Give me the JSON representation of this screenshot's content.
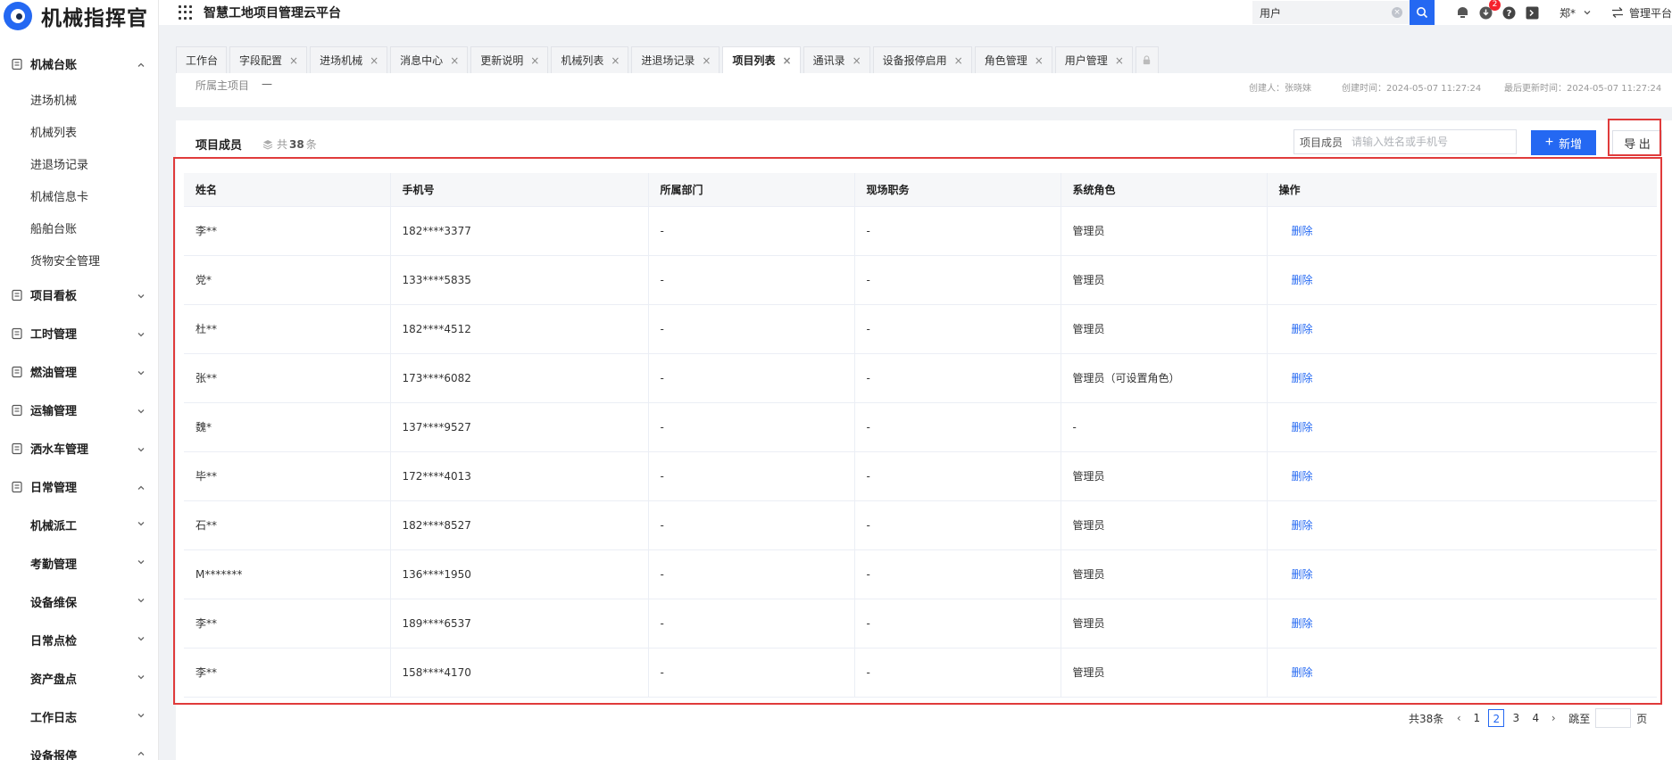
{
  "brand": {
    "name": "机械指挥官",
    "accent": "#2468f2",
    "highlight": "#e03b3b"
  },
  "topbar": {
    "title": "智慧工地项目管理云平台",
    "search_value": "用户",
    "notification_badge": "2",
    "user_name": "郑*",
    "switch_label": "管理平台",
    "icons": [
      "grid-icon",
      "search-icon",
      "message-icon",
      "download-icon",
      "help-icon",
      "terminal-icon",
      "swap-icon"
    ]
  },
  "sidebar": {
    "groups": [
      {
        "label": "机械台账",
        "icon": "ledger-icon",
        "expanded": true,
        "items": [
          "进场机械",
          "机械列表",
          "进退场记录",
          "机械信息卡",
          "船舶台账",
          "货物安全管理"
        ]
      },
      {
        "label": "项目看板",
        "icon": "dashboard-icon",
        "expanded": false
      },
      {
        "label": "工时管理",
        "icon": "clock-icon",
        "expanded": false
      },
      {
        "label": "燃油管理",
        "icon": "fuel-icon",
        "expanded": false
      },
      {
        "label": "运输管理",
        "icon": "truck-icon",
        "expanded": false
      },
      {
        "label": "洒水车管理",
        "icon": "sprinkler-icon",
        "expanded": false
      },
      {
        "label": "日常管理",
        "icon": "clipboard-icon",
        "expanded": true,
        "subgroups": [
          "机械派工",
          "考勤管理",
          "设备维保",
          "日常点检",
          "资产盘点",
          "工作日志",
          "设备报停"
        ]
      }
    ]
  },
  "tabs": [
    {
      "label": "工作台",
      "closable": false
    },
    {
      "label": "字段配置",
      "closable": true
    },
    {
      "label": "进场机械",
      "closable": true
    },
    {
      "label": "消息中心",
      "closable": true
    },
    {
      "label": "更新说明",
      "closable": true
    },
    {
      "label": "机械列表",
      "closable": true
    },
    {
      "label": "进退场记录",
      "closable": true
    },
    {
      "label": "项目列表",
      "closable": true,
      "active": true
    },
    {
      "label": "通讯录",
      "closable": true
    },
    {
      "label": "设备报停启用",
      "closable": true
    },
    {
      "label": "角色管理",
      "closable": true
    },
    {
      "label": "用户管理",
      "closable": true
    }
  ],
  "info": {
    "parent_label": "所属主项目",
    "parent_value": "—",
    "creator": "创建人：张晓妹",
    "created": "创建时间：2024-05-07 11:27:24",
    "updated": "最后更新时间：2024-05-07 11:27:24"
  },
  "members": {
    "title": "项目成员",
    "count_prefix": "共",
    "count": "38",
    "count_suffix": "条",
    "filter_label": "项目成员",
    "filter_placeholder": "请输入姓名或手机号",
    "add_label": "新增",
    "export_label": "导 出",
    "columns": [
      "姓名",
      "手机号",
      "所属部门",
      "现场职务",
      "系统角色",
      "操作"
    ],
    "rows": [
      [
        "李**",
        "182****3377",
        "-",
        "-",
        "管理员",
        "删除"
      ],
      [
        "党*",
        "133****5835",
        "-",
        "-",
        "管理员",
        "删除"
      ],
      [
        "杜**",
        "182****4512",
        "-",
        "-",
        "管理员",
        "删除"
      ],
      [
        "张**",
        "173****6082",
        "-",
        "-",
        "管理员（可设置角色）",
        "删除"
      ],
      [
        "魏*",
        "137****9527",
        "-",
        "-",
        "-",
        "删除"
      ],
      [
        "毕**",
        "172****4013",
        "-",
        "-",
        "管理员",
        "删除"
      ],
      [
        "石**",
        "182****8527",
        "-",
        "-",
        "管理员",
        "删除"
      ],
      [
        "M*******",
        "136****1950",
        "-",
        "-",
        "管理员",
        "删除"
      ],
      [
        "李**",
        "189****6537",
        "-",
        "-",
        "管理员",
        "删除"
      ],
      [
        "李**",
        "158****4170",
        "-",
        "-",
        "管理员",
        "删除"
      ]
    ]
  },
  "pagination": {
    "total": "共38条",
    "pages": [
      "1",
      "2",
      "3",
      "4"
    ],
    "current": "2",
    "jump_label": "跳至",
    "page_suffix": "页"
  }
}
